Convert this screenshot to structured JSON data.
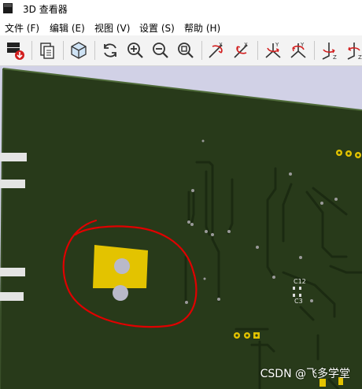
{
  "window": {
    "title": "3D 查看器"
  },
  "menu": {
    "items": [
      {
        "label": "文件 (F)"
      },
      {
        "label": "编辑 (E)"
      },
      {
        "label": "视图 (V)"
      },
      {
        "label": "设置 (S)"
      },
      {
        "label": "帮助 (H)"
      }
    ]
  },
  "toolbar": {
    "icons": [
      "export-icon",
      "copy-icon",
      "3d-view-icon",
      "refresh-icon",
      "zoom-in-icon",
      "zoom-out-icon",
      "zoom-fit-icon",
      "rotate-x-cw-icon",
      "rotate-x-ccw-icon",
      "rotate-y-cw-icon",
      "rotate-y-ccw-icon",
      "rotate-z-cw-icon",
      "rotate-z-ccw-icon"
    ]
  },
  "pcb": {
    "labels": {
      "c12": "C12",
      "c3": "C3"
    },
    "colors": {
      "board": "#283a1a",
      "copper_pad": "#e3c300",
      "background": "#d1d1e6",
      "annotation": "#e00000"
    }
  },
  "watermark": {
    "text": "CSDN @飞多学堂"
  }
}
